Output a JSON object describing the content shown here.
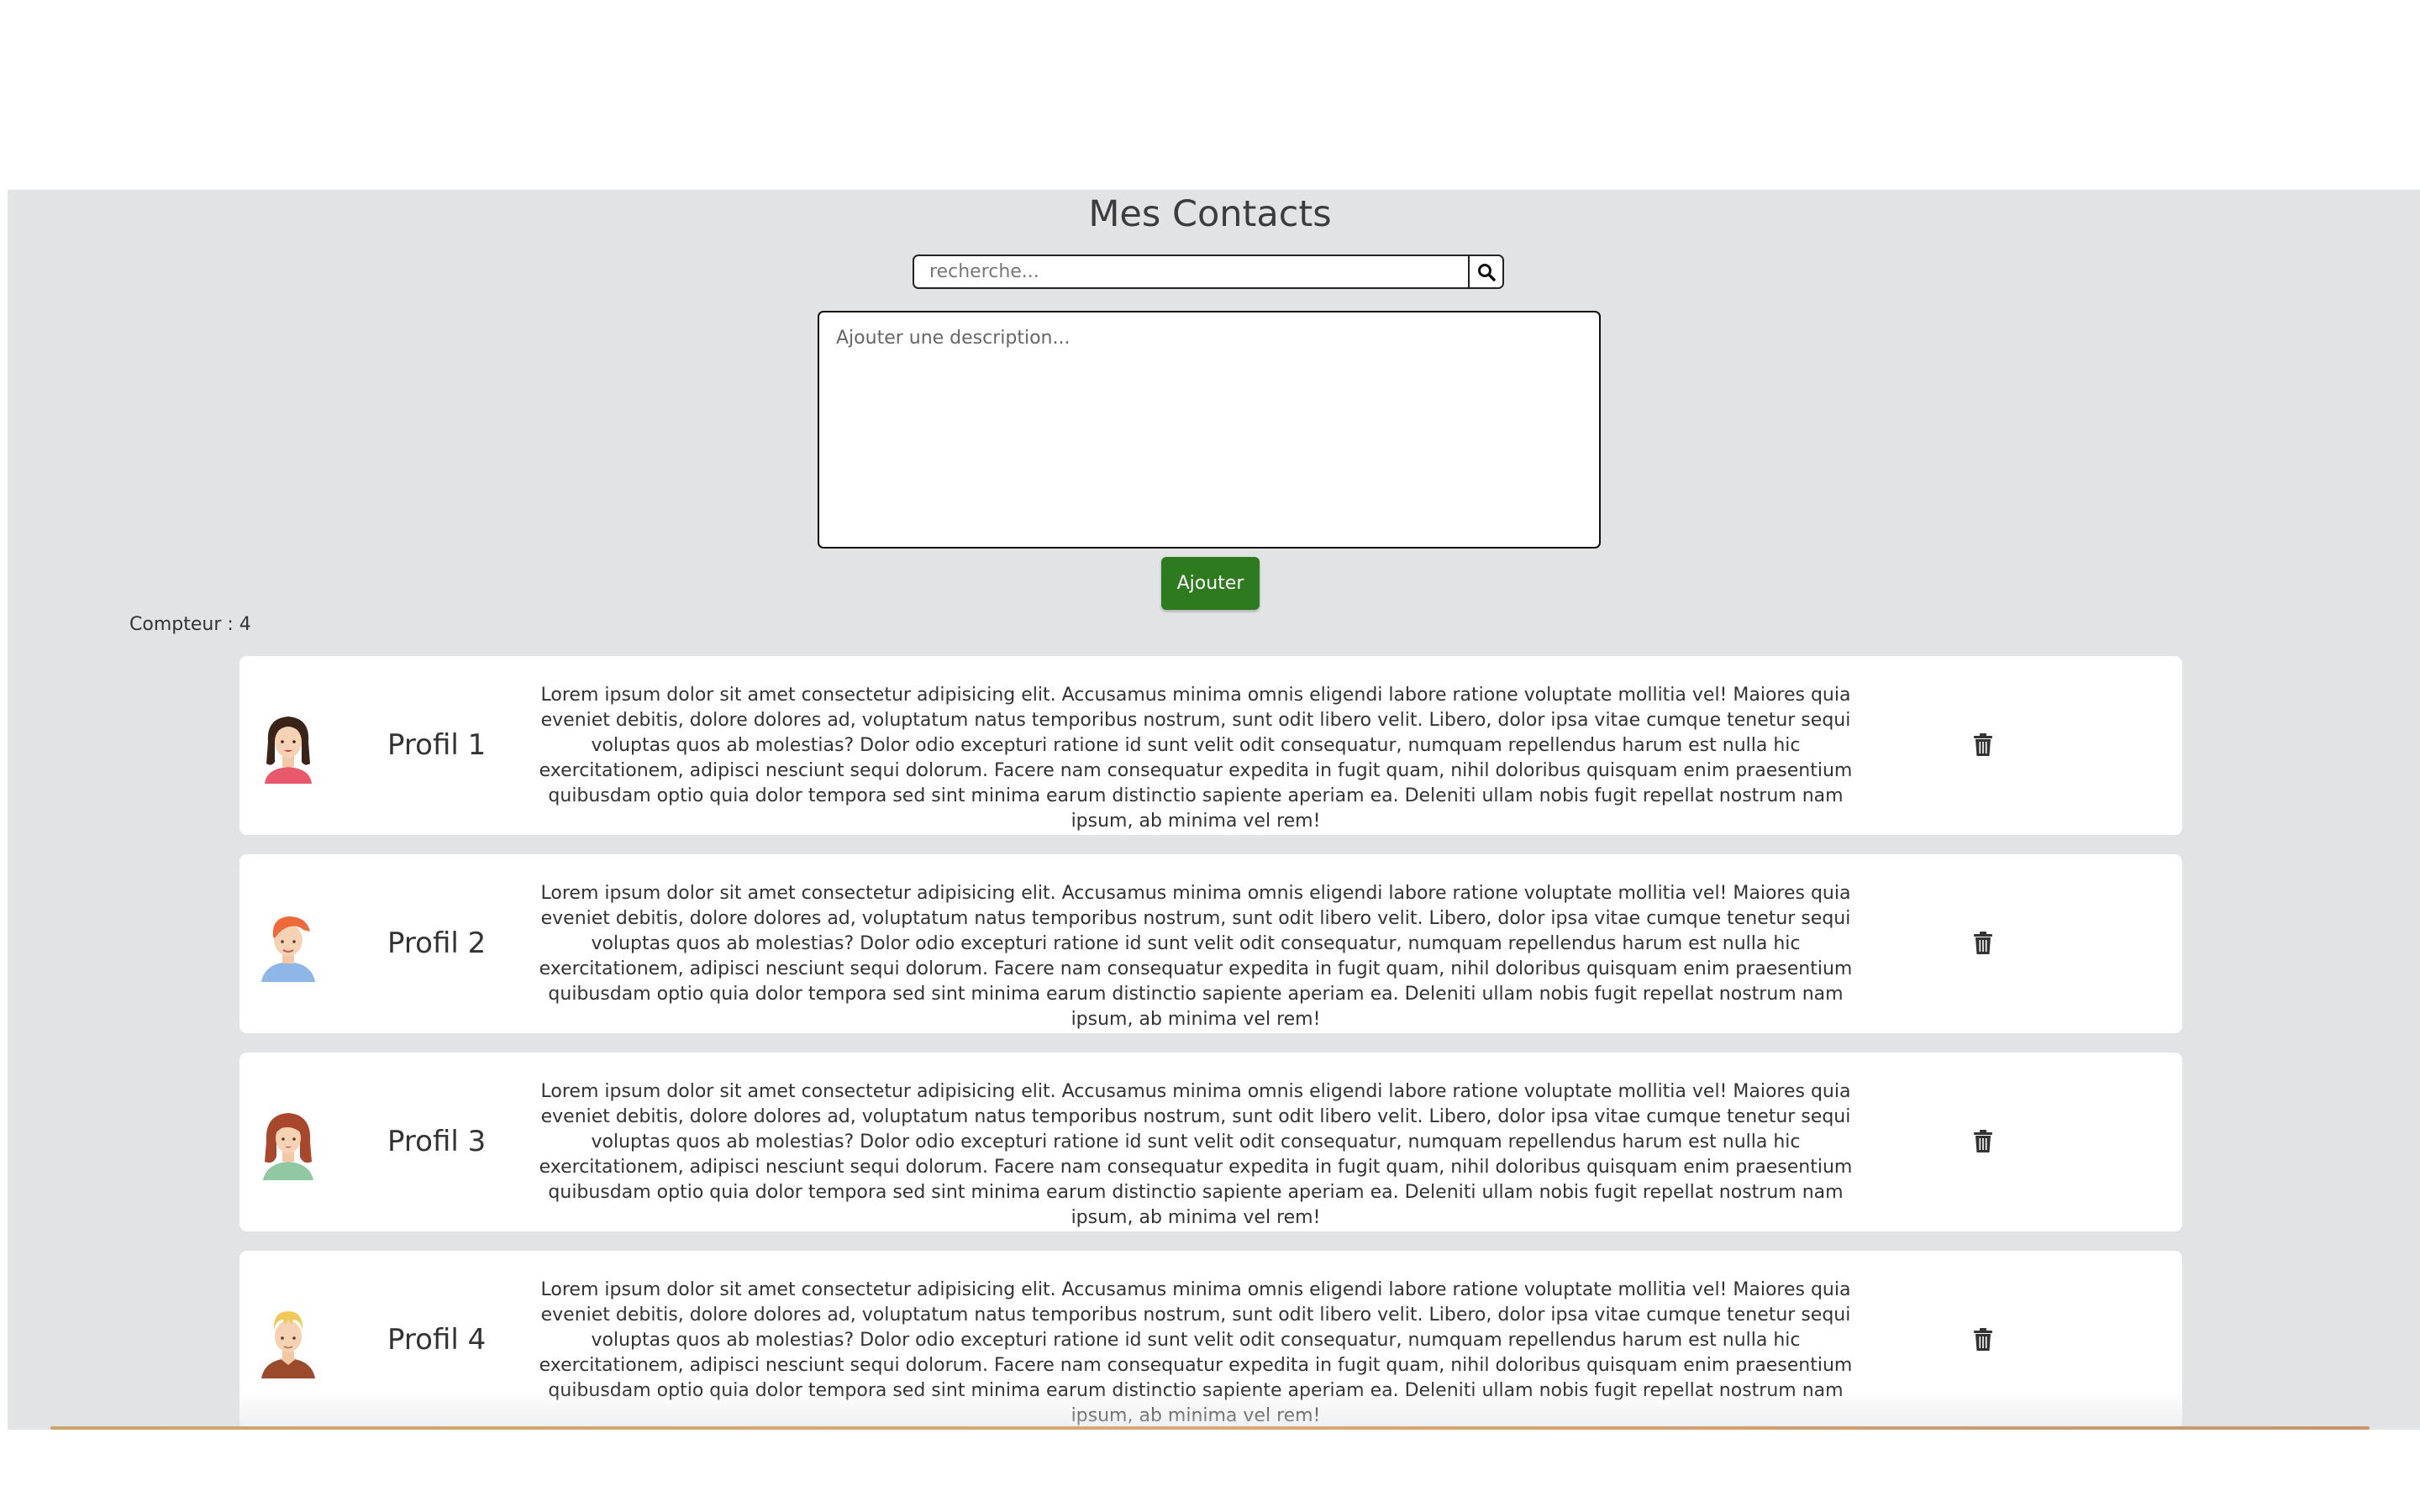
{
  "header": {
    "title": "Mes Contacts"
  },
  "search": {
    "placeholder": "recherche...",
    "icon": "search-icon"
  },
  "description_field": {
    "placeholder": "Ajouter une description..."
  },
  "add_button": {
    "label": "Ajouter",
    "color": "#2e7a1f"
  },
  "counter": {
    "label": "Compteur : 4"
  },
  "contacts": [
    {
      "name": "Profil 1",
      "avatar": "woman-dark-hair-avatar",
      "description": "Lorem ipsum dolor sit amet consectetur adipisicing elit. Accusamus minima omnis eligendi labore ratione voluptate mollitia vel! Maiores quia eveniet debitis, dolore dolores ad, voluptatum natus temporibus nostrum, sunt odit libero velit. Libero, dolor ipsa vitae cumque tenetur sequi voluptas quos ab molestias? Dolor odio excepturi ratione id sunt velit odit consequatur, numquam repellendus harum est nulla hic exercitationem, adipisci nesciunt sequi dolorum. Facere nam consequatur expedita in fugit quam, nihil doloribus quisquam enim praesentium quibusdam optio quia dolor tempora sed sint minima earum distinctio sapiente aperiam ea. Deleniti ullam nobis fugit repellat nostrum nam ipsum, ab minima vel rem!"
    },
    {
      "name": "Profil 2",
      "avatar": "man-orange-hair-avatar",
      "description": "Lorem ipsum dolor sit amet consectetur adipisicing elit. Accusamus minima omnis eligendi labore ratione voluptate mollitia vel! Maiores quia eveniet debitis, dolore dolores ad, voluptatum natus temporibus nostrum, sunt odit libero velit. Libero, dolor ipsa vitae cumque tenetur sequi voluptas quos ab molestias? Dolor odio excepturi ratione id sunt velit odit consequatur, numquam repellendus harum est nulla hic exercitationem, adipisci nesciunt sequi dolorum. Facere nam consequatur expedita in fugit quam, nihil doloribus quisquam enim praesentium quibusdam optio quia dolor tempora sed sint minima earum distinctio sapiente aperiam ea. Deleniti ullam nobis fugit repellat nostrum nam ipsum, ab minima vel rem!"
    },
    {
      "name": "Profil 3",
      "avatar": "woman-auburn-hair-avatar",
      "description": "Lorem ipsum dolor sit amet consectetur adipisicing elit. Accusamus minima omnis eligendi labore ratione voluptate mollitia vel! Maiores quia eveniet debitis, dolore dolores ad, voluptatum natus temporibus nostrum, sunt odit libero velit. Libero, dolor ipsa vitae cumque tenetur sequi voluptas quos ab molestias? Dolor odio excepturi ratione id sunt velit odit consequatur, numquam repellendus harum est nulla hic exercitationem, adipisci nesciunt sequi dolorum. Facere nam consequatur expedita in fugit quam, nihil doloribus quisquam enim praesentium quibusdam optio quia dolor tempora sed sint minima earum distinctio sapiente aperiam ea. Deleniti ullam nobis fugit repellat nostrum nam ipsum, ab minima vel rem!"
    },
    {
      "name": "Profil 4",
      "avatar": "man-blond-hair-avatar",
      "description": "Lorem ipsum dolor sit amet consectetur adipisicing elit. Accusamus minima omnis eligendi labore ratione voluptate mollitia vel! Maiores quia eveniet debitis, dolore dolores ad, voluptatum natus temporibus nostrum, sunt odit libero velit. Libero, dolor ipsa vitae cumque tenetur sequi voluptas quos ab molestias? Dolor odio excepturi ratione id sunt velit odit consequatur, numquam repellendus harum est nulla hic exercitationem, adipisci nesciunt sequi dolorum. Facere nam consequatur expedita in fugit quam, nihil doloribus quisquam enim praesentium quibusdam optio quia dolor tempora sed sint minima earum distinctio sapiente aperiam ea. Deleniti ullam nobis fugit repellat nostrum nam ipsum, ab minima vel rem!"
    }
  ],
  "delete_icon": "trash-icon",
  "colors": {
    "page_background": "#e2e3e5",
    "card_background": "#ffffff",
    "accent_green": "#2e7a1f"
  }
}
